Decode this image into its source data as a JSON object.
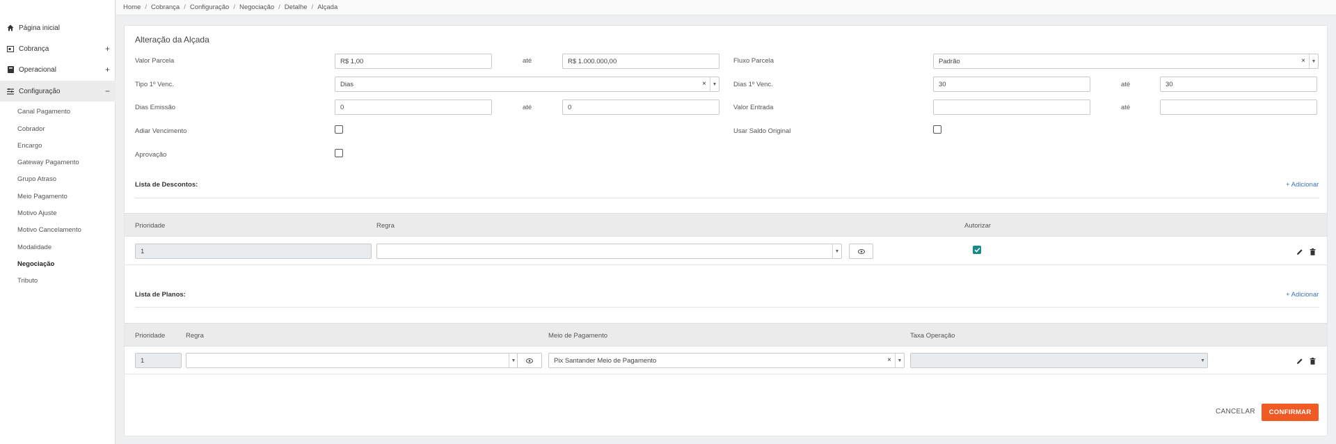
{
  "sidebar": {
    "items": [
      {
        "label": "Página inicial",
        "icon": "home-icon",
        "expander": ""
      },
      {
        "label": "Cobrança",
        "icon": "card-icon",
        "expander": "+"
      },
      {
        "label": "Operacional",
        "icon": "box-icon",
        "expander": "+"
      },
      {
        "label": "Configuração",
        "icon": "settings-list-icon",
        "expander": "−"
      }
    ],
    "subitems": [
      "Canal Pagamento",
      "Cobrador",
      "Encargo",
      "Gateway Pagamento",
      "Grupo Atraso",
      "Meio Pagamento",
      "Motivo Ajuste",
      "Motivo Cancelamento",
      "Modalidade",
      "Negociação",
      "Tributo"
    ]
  },
  "breadcrumb": [
    "Home",
    "Cobrança",
    "Configuração",
    "Negociação",
    "Detalhe",
    "Alçada"
  ],
  "form": {
    "title": "Alteração da Alçada",
    "ate": "até",
    "valor_parcela": {
      "label": "Valor Parcela",
      "from": "R$ 1,00",
      "to": "R$ 1.000.000,00"
    },
    "fluxo_parcela": {
      "label": "Fluxo Parcela",
      "value": "Padrão"
    },
    "tipo_venc": {
      "label": "Tipo 1º Venc.",
      "value": "Dias"
    },
    "dias_venc": {
      "label": "Dias 1º Venc.",
      "from": "30",
      "to": "30"
    },
    "dias_emissao": {
      "label": "Dias Emissão",
      "from": "0",
      "to": "0"
    },
    "valor_entrada": {
      "label": "Valor Entrada",
      "from": "",
      "to": ""
    },
    "adiar_vencimento": {
      "label": "Adiar Vencimento",
      "checked": false
    },
    "usar_saldo": {
      "label": "Usar Saldo Original",
      "checked": false
    },
    "aprovacao": {
      "label": "Aprovação",
      "checked": false
    }
  },
  "descontos": {
    "title": "Lista de Descontos:",
    "add_label": "+ Adicionar",
    "columns": [
      "Prioridade",
      "Regra",
      "Autorizar"
    ],
    "rows": [
      {
        "prioridade": "1",
        "regra": "",
        "autorizar": true
      }
    ]
  },
  "planos": {
    "title": "Lista de Planos:",
    "add_label": "+ Adicionar",
    "columns": [
      "Prioridade",
      "Regra",
      "Meio de Pagamento",
      "Taxa Operação"
    ],
    "rows": [
      {
        "prioridade": "1",
        "regra": "",
        "meio_pagamento": "Pix Santander Meio de Pagamento",
        "taxa_operacao": ""
      }
    ]
  },
  "actions": {
    "cancel": "CANCELAR",
    "confirm": "CONFIRMAR"
  },
  "colors": {
    "accent": "#f05a24",
    "check": "#158a8a",
    "link": "#3b6fb6"
  }
}
